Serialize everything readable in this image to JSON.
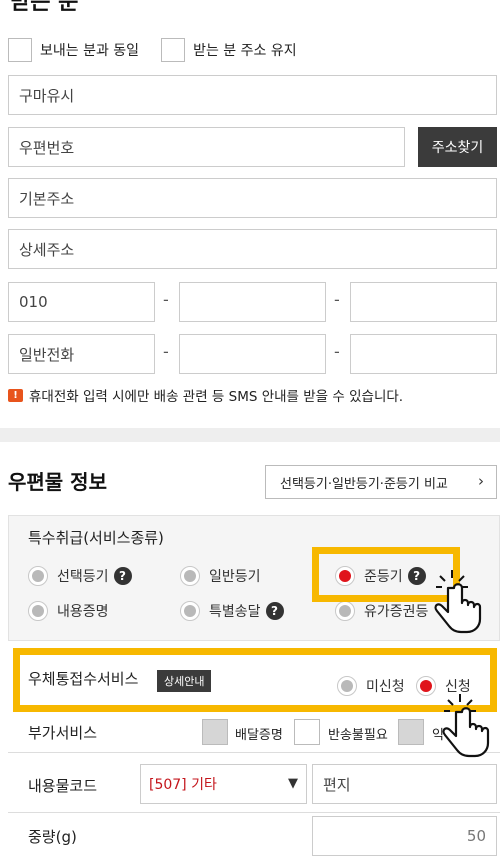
{
  "recipient": {
    "heading": "받는 분",
    "checkbox_same_sender": "보내는 분과 동일",
    "checkbox_keep_address": "받는 분 주소 유지",
    "name_value": "구마유시",
    "postcode_placeholder": "우편번호",
    "find_address_button": "주소찾기",
    "base_address_placeholder": "기본주소",
    "detail_address_placeholder": "상세주소",
    "mobile_prefix": "010",
    "phone_placeholder": "일반전화",
    "dash": "-",
    "notice_icon": "!",
    "notice_text": "휴대전화 입력 시에만 배송 관련 등 SMS 안내를 받을 수 있습니다."
  },
  "mail_info": {
    "title": "우편물 정보",
    "compare_button": "선택등기·일반등기·준등기 비교",
    "compare_arrow": "›",
    "special_handling_title": "특수취급(서비스종류)",
    "options": [
      {
        "label": "선택등기",
        "help": "?",
        "selected": false
      },
      {
        "label": "일반등기",
        "help": "",
        "selected": false
      },
      {
        "label": "준등기",
        "help": "?",
        "selected": true
      },
      {
        "label": "내용증명",
        "help": "",
        "selected": false
      },
      {
        "label": "특별송달",
        "help": "?",
        "selected": false
      },
      {
        "label": "유가증권등",
        "help": "",
        "selected": false
      }
    ],
    "window_service_label": "우체통접수서비스",
    "detail_badge": "상세안내",
    "window_options": [
      {
        "label": "미신청",
        "selected": false
      },
      {
        "label": "신청",
        "selected": true
      }
    ],
    "extra_service_label": "부가서비스",
    "extra_options": [
      "배달증명",
      "반송불필요",
      "익"
    ],
    "content_code_label": "내용물코드",
    "content_code_value": "[507] 기타",
    "content_code_caret": "▼",
    "content_name_value": "편지",
    "weight_label": "중량(g)",
    "weight_value": "50"
  },
  "colors": {
    "accent_yellow": "#f7b800",
    "radio_selected": "#e0141b",
    "dark_button": "#3b3b3b"
  }
}
